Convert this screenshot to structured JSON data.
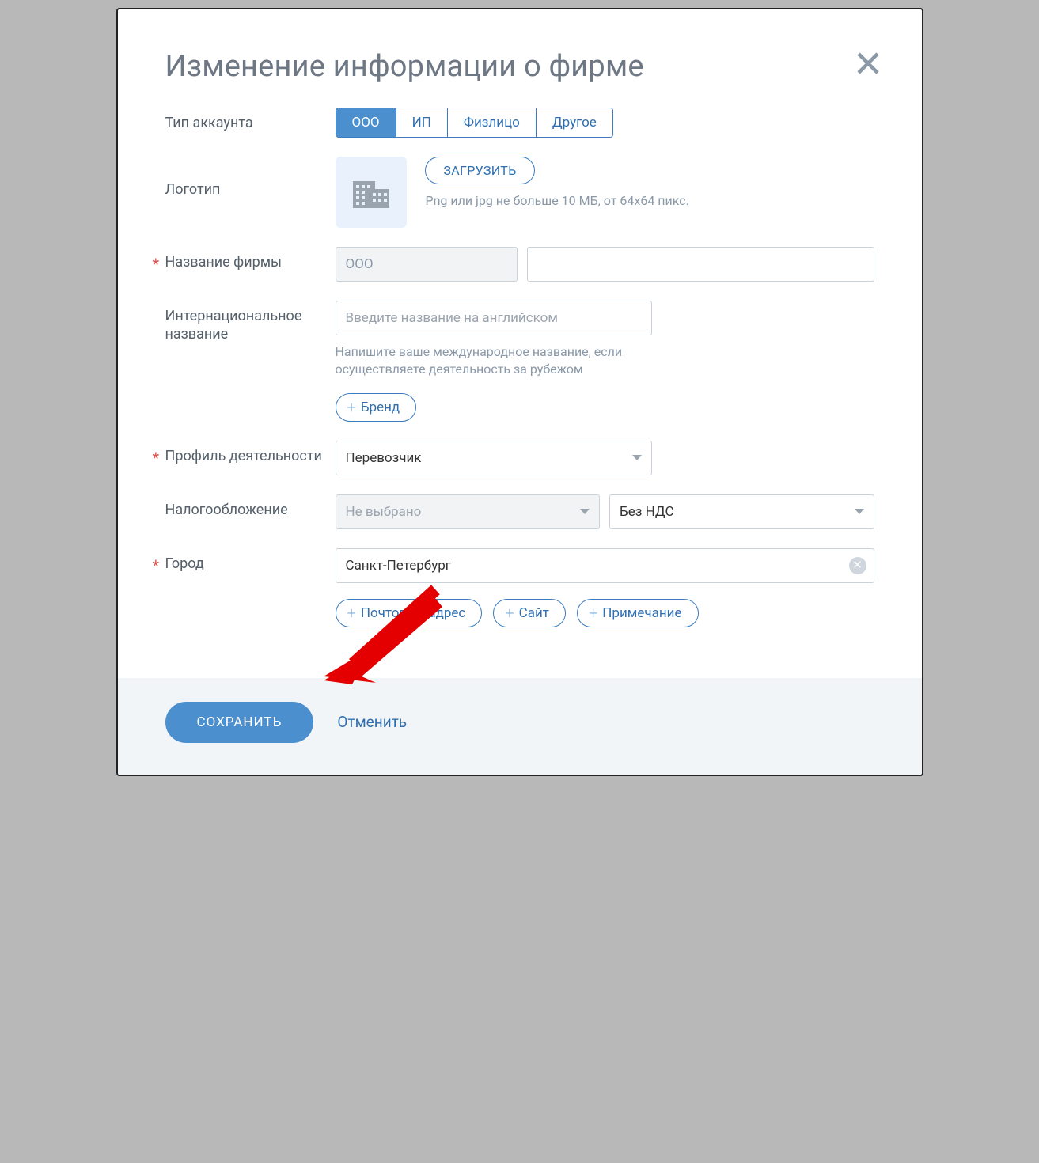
{
  "modal_title": "Изменение информации о фирме",
  "account_type": {
    "label": "Тип аккаунта",
    "options": [
      "ООО",
      "ИП",
      "Физлицо",
      "Другое"
    ],
    "active_index": 0
  },
  "logo": {
    "label": "Логотип",
    "upload_btn": "ЗАГРУЗИТЬ",
    "hint": "Png или jpg не больше 10 МБ, от 64х64 пикс."
  },
  "company_name": {
    "label": "Название фирмы",
    "prefix_value": "ООО",
    "value": ""
  },
  "intl_name": {
    "label": "Интернациональное название",
    "placeholder": "Введите название на английском",
    "hint": "Напишите ваше международное название, если осуществляете деятельность за рубежом",
    "brand_btn": "Бренд"
  },
  "profile": {
    "label": "Профиль деятельности",
    "value": "Перевозчик"
  },
  "tax": {
    "label": "Налогообложение",
    "left_value": "Не выбрано",
    "right_value": "Без НДС"
  },
  "city": {
    "label": "Город",
    "value": "Санкт-Петербург"
  },
  "extra_chips": {
    "postal": "Почтовый адрес",
    "site": "Сайт",
    "note": "Примечание"
  },
  "footer": {
    "save": "СОХРАНИТЬ",
    "cancel": "Отменить"
  }
}
